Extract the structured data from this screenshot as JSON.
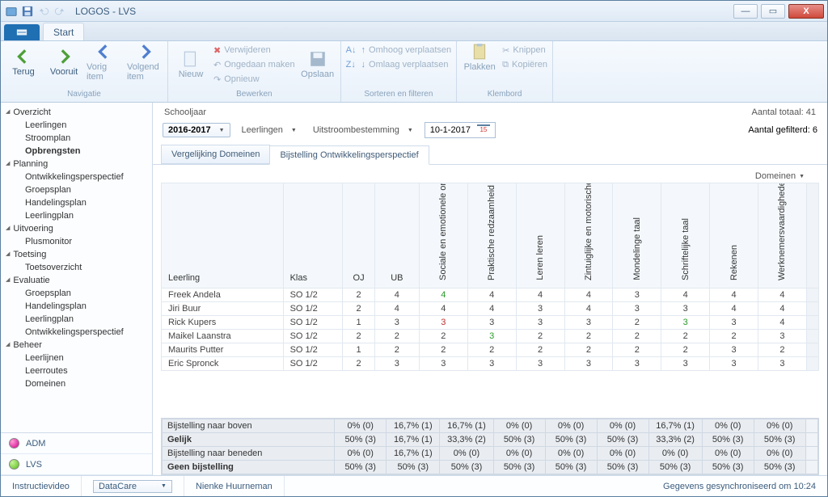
{
  "window": {
    "title": "LOGOS - LVS"
  },
  "ribbon": {
    "tab_start": "Start",
    "groups": {
      "nav": {
        "terug": "Terug",
        "vooruit": "Vooruit",
        "vorig": "Vorig item",
        "volgend": "Volgend item",
        "label": "Navigatie"
      },
      "edit": {
        "nieuw": "Nieuw",
        "verwijderen": "Verwijderen",
        "ongedaan": "Ongedaan maken",
        "opnieuw": "Opnieuw",
        "opslaan": "Opslaan",
        "label": "Bewerken"
      },
      "sort": {
        "az": "",
        "omhoog": "Omhoog verplaatsen",
        "omlaag": "Omlaag verplaatsen",
        "label": "Sorteren en filteren"
      },
      "clip": {
        "plakken": "Plakken",
        "knippen": "Knippen",
        "kopieren": "Kopiëren",
        "label": "Klembord"
      }
    }
  },
  "sidebar": {
    "groups": [
      {
        "label": "Overzicht",
        "items": [
          "Leerlingen",
          "Stroomplan",
          "Opbrengsten"
        ]
      },
      {
        "label": "Planning",
        "items": [
          "Ontwikkelingsperspectief",
          "Groepsplan",
          "Handelingsplan",
          "Leerlingplan"
        ]
      },
      {
        "label": "Uitvoering",
        "items": [
          "Plusmonitor"
        ]
      },
      {
        "label": "Toetsing",
        "items": [
          "Toetsoverzicht"
        ]
      },
      {
        "label": "Evaluatie",
        "items": [
          "Groepsplan",
          "Handelingsplan",
          "Leerlingplan",
          "Ontwikkelingsperspectief"
        ]
      },
      {
        "label": "Beheer",
        "items": [
          "Leerlijnen",
          "Leerroutes",
          "Domeinen"
        ]
      }
    ],
    "selected": "Opbrengsten",
    "modules": {
      "adm": "ADM",
      "lvs": "LVS"
    }
  },
  "filters": {
    "schooljaar_label": "Schooljaar",
    "schooljaar": "2016-2017",
    "leerlingen": "Leerlingen",
    "uitstroom": "Uitstroombestemming",
    "datum": "10-1-2017",
    "totaal_label": "Aantal totaal: 41",
    "gefilterd_label": "Aantal gefilterd: 6"
  },
  "tabs": {
    "a": "Vergelijking Domeinen",
    "b": "Bijstelling Ontwikkelingsperspectief"
  },
  "grid": {
    "domeinen_dd": "Domeinen",
    "headers": {
      "leerling": "Leerling",
      "klas": "Klas",
      "oj": "OJ",
      "ub": "UB",
      "d0": "Sociale en emotionele ontwikkeling",
      "d1": "Praktische redzaamheid",
      "d2": "Leren leren",
      "d3": "Zintuiglijke en motorische ontwikkeling",
      "d4": "Mondelinge taal",
      "d5": "Schriftelijke taal",
      "d6": "Rekenen",
      "d7": "Werknemersvaardigheden"
    },
    "rows": [
      {
        "leerling": "Freek Andela",
        "klas": "SO 1/2",
        "oj": "2",
        "ub": "4",
        "v": [
          "4",
          "4",
          "4",
          "4",
          "3",
          "4",
          "4",
          "4"
        ],
        "cls": [
          "green",
          "",
          "",
          "",
          "",
          "",
          "",
          ""
        ]
      },
      {
        "leerling": "Jiri Buur",
        "klas": "SO 1/2",
        "oj": "2",
        "ub": "4",
        "v": [
          "4",
          "4",
          "3",
          "4",
          "3",
          "3",
          "4",
          "4"
        ],
        "cls": [
          "",
          "",
          "",
          "",
          "",
          "",
          "",
          ""
        ]
      },
      {
        "leerling": "Rick Kupers",
        "klas": "SO 1/2",
        "oj": "1",
        "ub": "3",
        "v": [
          "3",
          "3",
          "3",
          "3",
          "2",
          "3",
          "3",
          "4"
        ],
        "cls": [
          "red",
          "",
          "",
          "",
          "",
          "green",
          "",
          ""
        ]
      },
      {
        "leerling": "Maikel Laanstra",
        "klas": "SO 1/2",
        "oj": "2",
        "ub": "2",
        "v": [
          "2",
          "3",
          "2",
          "2",
          "2",
          "2",
          "2",
          "3"
        ],
        "cls": [
          "",
          "green",
          "",
          "",
          "",
          "",
          "",
          ""
        ]
      },
      {
        "leerling": "Maurits Putter",
        "klas": "SO 1/2",
        "oj": "1",
        "ub": "2",
        "v": [
          "2",
          "2",
          "2",
          "2",
          "2",
          "2",
          "3",
          "2"
        ],
        "cls": [
          "",
          "",
          "",
          "",
          "",
          "",
          "",
          ""
        ]
      },
      {
        "leerling": "Eric Spronck",
        "klas": "SO 1/2",
        "oj": "2",
        "ub": "3",
        "v": [
          "3",
          "3",
          "3",
          "3",
          "3",
          "3",
          "3",
          "3"
        ],
        "cls": [
          "",
          "",
          "",
          "",
          "",
          "",
          "",
          ""
        ]
      }
    ]
  },
  "summary": {
    "rows": [
      {
        "label": "Bijstelling naar boven",
        "bold": false,
        "v": [
          "0% (0)",
          "16,7% (1)",
          "16,7% (1)",
          "0% (0)",
          "0% (0)",
          "0% (0)",
          "16,7% (1)",
          "0% (0)",
          "0% (0)"
        ]
      },
      {
        "label": "Gelijk",
        "bold": true,
        "v": [
          "50% (3)",
          "16,7% (1)",
          "33,3% (2)",
          "50% (3)",
          "50% (3)",
          "50% (3)",
          "33,3% (2)",
          "50% (3)",
          "50% (3)"
        ]
      },
      {
        "label": "Bijstelling naar beneden",
        "bold": false,
        "v": [
          "0% (0)",
          "16,7% (1)",
          "0% (0)",
          "0% (0)",
          "0% (0)",
          "0% (0)",
          "0% (0)",
          "0% (0)",
          "0% (0)"
        ]
      },
      {
        "label": "Geen bijstelling",
        "bold": true,
        "v": [
          "50% (3)",
          "50% (3)",
          "50% (3)",
          "50% (3)",
          "50% (3)",
          "50% (3)",
          "50% (3)",
          "50% (3)",
          "50% (3)"
        ]
      }
    ]
  },
  "status": {
    "instructie": "Instructievideo",
    "datacare": "DataCare",
    "user": "Nienke Huurneman",
    "sync": "Gegevens gesynchroniseerd om 10:24"
  }
}
